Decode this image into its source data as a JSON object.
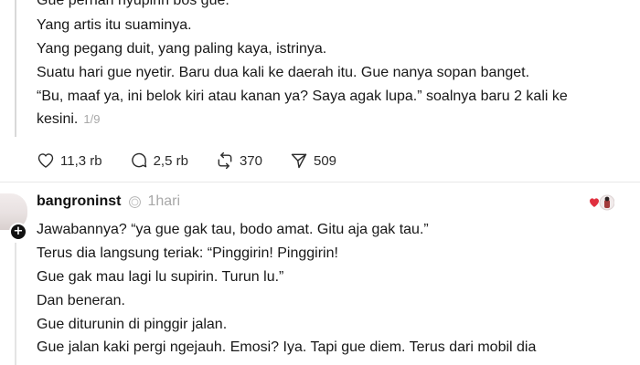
{
  "post": {
    "lines": [
      "Gue pernah nyupirin bos gue.",
      "Yang artis itu suaminya.",
      "Yang pegang duit, yang paling kaya, istrinya.",
      "Suatu hari gue nyetir. Baru dua kali ke daerah itu. Gue nanya sopan banget.",
      "“Bu, maaf ya, ini belok kiri atau kanan ya? Saya agak lupa.” soalnya baru 2 kali ke",
      "kesini."
    ],
    "page_indicator": "1/9",
    "actions": {
      "likes": "11,3 rb",
      "comments": "2,5 rb",
      "reposts": "370",
      "shares": "509"
    }
  },
  "reply": {
    "username": "bangroninst",
    "timestamp": "1hari",
    "lines": [
      "Jawabannya? “ya gue gak tau, bodo amat. Gitu aja gak tau.”",
      "Terus dia langsung teriak: “Pinggirin! Pinggirin!",
      "Gue gak mau lagi lu supirin. Turun lu.”",
      "Dan beneran.",
      "Gue diturunin di pinggir jalan.",
      "Gue jalan kaki pergi ngejauh. Emosi? Iya. Tapi gue diem. Terus dari mobil dia"
    ]
  },
  "icons": {
    "like": "heart-icon",
    "comment": "speech-bubble-icon",
    "repost": "repost-arrows-icon",
    "share": "paper-plane-icon",
    "verified": "verified-badge-icon",
    "follow": "plus-icon"
  }
}
